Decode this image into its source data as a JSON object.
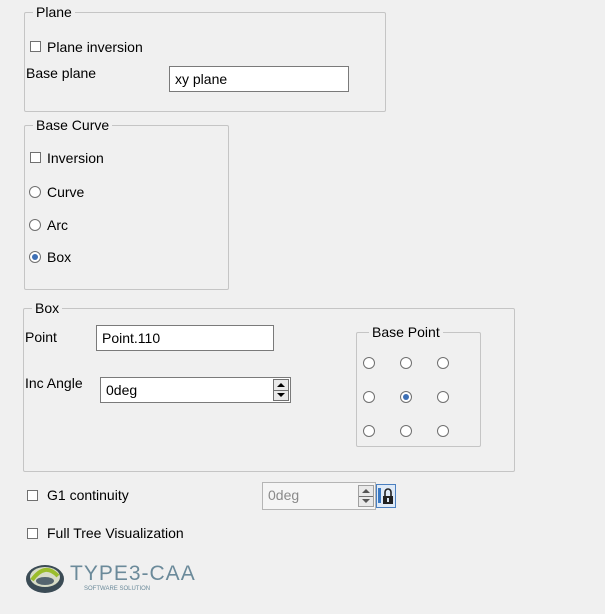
{
  "plane": {
    "title": "Plane",
    "inversion_label": "Plane inversion",
    "inversion_checked": false,
    "base_plane_label": "Base plane",
    "base_plane_value": "xy plane"
  },
  "base_curve": {
    "title": "Base Curve",
    "inversion_label": "Inversion",
    "inversion_checked": false,
    "options": [
      {
        "label": "Curve",
        "selected": false
      },
      {
        "label": "Arc",
        "selected": false
      },
      {
        "label": "Box",
        "selected": true
      }
    ]
  },
  "box": {
    "title": "Box",
    "point_label": "Point",
    "point_value": "Point.110",
    "inc_angle_label": "Inc Angle",
    "inc_angle_value": "0deg",
    "base_point": {
      "title": "Base Point",
      "selected_row": 1,
      "selected_col": 1
    }
  },
  "g1": {
    "label": "G1 continuity",
    "checked": false,
    "value": "0deg",
    "enabled": false
  },
  "full_tree": {
    "label": "Full Tree Visualization",
    "checked": false
  },
  "logo": {
    "name": "TYPE3-CAA",
    "tagline": "SOFTWARE SOLUTION",
    "color": "#6b8a9a"
  },
  "icons": {
    "lock": "padlock-icon",
    "radio_selected_color": "#3d6fb5"
  }
}
